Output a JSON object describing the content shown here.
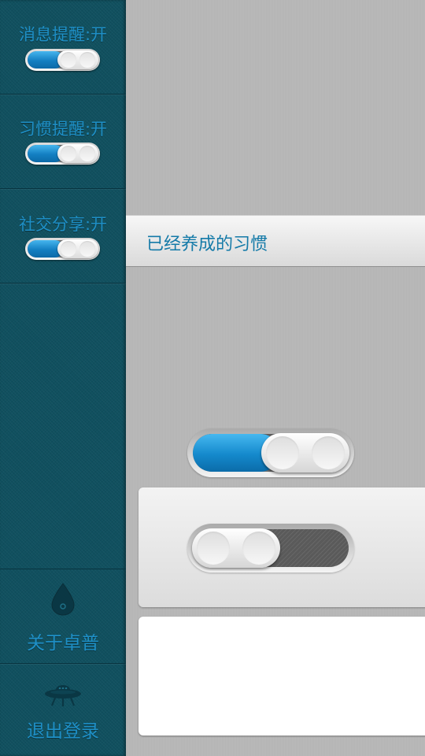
{
  "sidebar": {
    "settings": [
      {
        "label": "消息提醒:开",
        "on": true
      },
      {
        "label": "习惯提醒:开",
        "on": true
      },
      {
        "label": "社交分享:开",
        "on": true
      }
    ],
    "about": {
      "label": "关于卓普",
      "icon": "droplet-icon"
    },
    "logout": {
      "label": "退出登录",
      "icon": "ufo-icon"
    }
  },
  "main": {
    "header": {
      "title": "已经养成的习惯"
    },
    "toggle_top": {
      "on": true
    },
    "toggle_bottom": {
      "on": false
    }
  },
  "colors": {
    "sidebar_bg": "#10505f",
    "accent_blue": "#1e8fc6",
    "title_blue": "#147aa8",
    "toggle_on": "#1489cc"
  }
}
